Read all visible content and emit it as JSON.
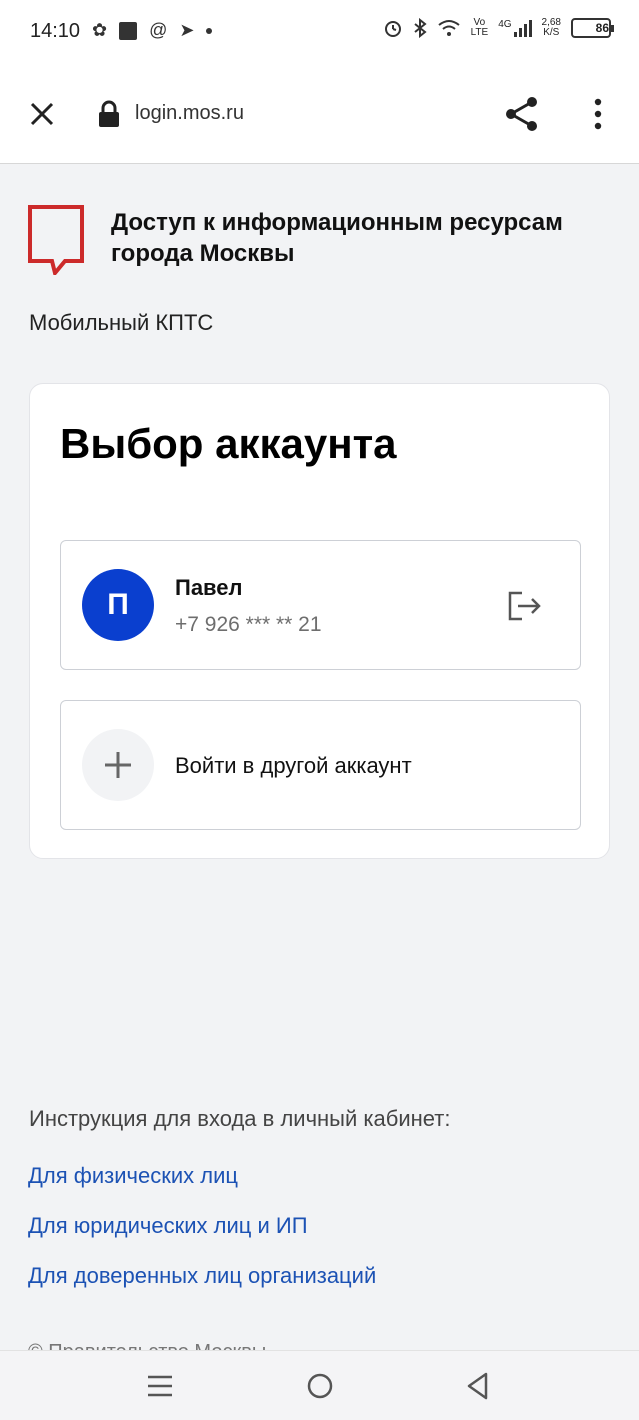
{
  "status_bar": {
    "time": "14:10",
    "net_speed_value": "2,68",
    "net_speed_unit": "K/S",
    "volte_top": "Vo",
    "volte_bottom": "LTE",
    "network": "4G",
    "battery": "86",
    "battery_level": 0.86
  },
  "browser": {
    "url": "login.mos.ru"
  },
  "header": {
    "title": "Доступ к информационным ресурсам города Москвы",
    "app_name": "Мобильный КПТС"
  },
  "card": {
    "title": "Выбор аккаунта",
    "account": {
      "avatar_letter": "П",
      "name": "Павел",
      "phone": "+7 926 *** ** 21"
    },
    "other_account_label": "Войти в другой аккаунт"
  },
  "instructions": {
    "heading": "Инструкция для входа в личный кабинет:",
    "links": [
      "Для физических лиц",
      "Для юридических лиц и ИП",
      "Для доверенных лиц организаций"
    ],
    "cut_text": "© Правительство Москвы"
  },
  "colors": {
    "accent_blue": "#0a3fcf",
    "link_blue": "#1c52b4",
    "logo_red": "#cc2a2a",
    "background": "#f2f3f5"
  },
  "icons": {
    "close": "close-icon",
    "lock": "lock-icon",
    "share": "share-icon",
    "more": "more-vertical-icon",
    "logout": "logout-icon",
    "plus": "plus-icon"
  }
}
